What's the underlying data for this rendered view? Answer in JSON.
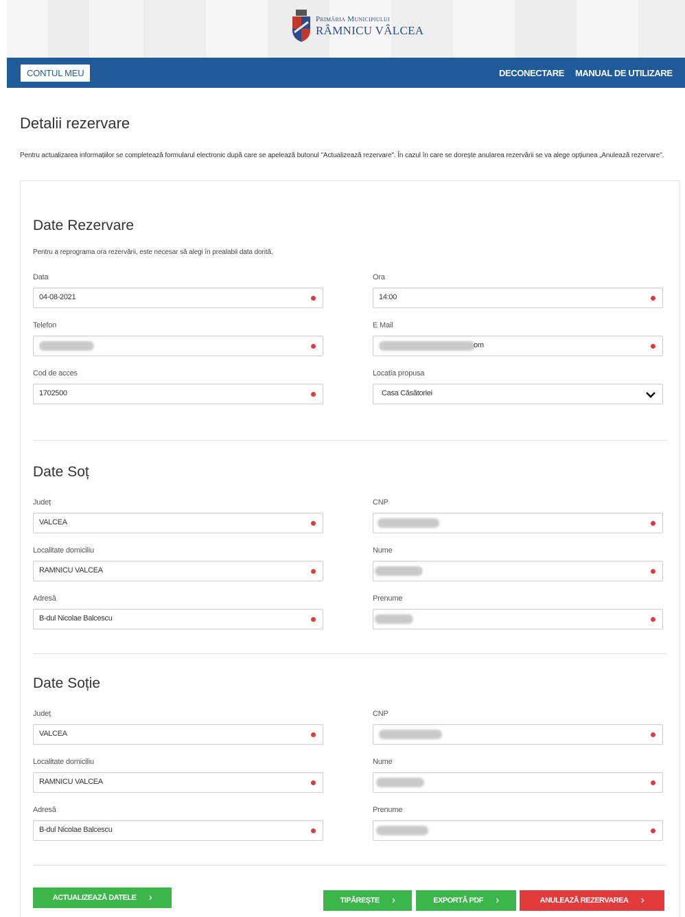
{
  "header": {
    "logo_line1": "Primăria Municipiului",
    "logo_line2": "RÂMNICU VÂLCEA"
  },
  "nav": {
    "account": "CONTUL MEU",
    "logout": "DECONECTARE",
    "manual": "MANUAL DE UTILIZARE"
  },
  "page": {
    "title": "Detalii rezervare",
    "intro": "Pentru actualizarea informațiilor se completează formularul electronic după care se apelează butonul \"Actualizează rezervare\". În cazul în care se dorește anularea rezervării se va alege opțiunea „Anulează rezervare\"."
  },
  "rezervare": {
    "title": "Date Rezervare",
    "note": "Pentru a reprograma ora rezervării, este necesar să alegi în prealabil data dorită.",
    "data_label": "Data",
    "data_value": "04-08-2021",
    "ora_label": "Ora",
    "ora_value": "14:00",
    "telefon_label": "Telefon",
    "email_label": "E Mail",
    "email_tail": "om",
    "cod_label": "Cod de acces",
    "cod_value": "1702500",
    "locatia_label": "Locatia propusa",
    "locatia_value": "Casa Căsătoriei"
  },
  "sot": {
    "title": "Date Soț",
    "judet_label": "Județ",
    "judet_value": "VALCEA",
    "cnp_label": "CNP",
    "localitate_label": "Localitate domiciliu",
    "localitate_value": "RAMNICU VALCEA",
    "nume_label": "Nume",
    "adresa_label": "Adresă",
    "adresa_value": "B-dul Nicolae Balcescu",
    "prenume_label": "Prenume"
  },
  "sotie": {
    "title": "Date Soție",
    "judet_label": "Județ",
    "judet_value": "VALCEA",
    "cnp_label": "CNP",
    "localitate_label": "Localitate domiciliu",
    "localitate_value": "RAMNICU VALCEA",
    "nume_label": "Nume",
    "adresa_label": "Adresă",
    "adresa_value": "B-dul Nicolae Balcescu",
    "prenume_label": "Prenume"
  },
  "buttons": {
    "update": "ACTUALIZEAZĂ DATELE",
    "print": "TIPĂREȘTE",
    "export": "EXPORTĂ PDF",
    "cancel": "ANULEAZĂ REZERVAREA",
    "chevron": "›"
  },
  "colors": {
    "nav_blue": "#1f5b99",
    "button_green": "#3cb54a",
    "button_red": "#e23b3b",
    "required_dot": "#d63f3f"
  }
}
